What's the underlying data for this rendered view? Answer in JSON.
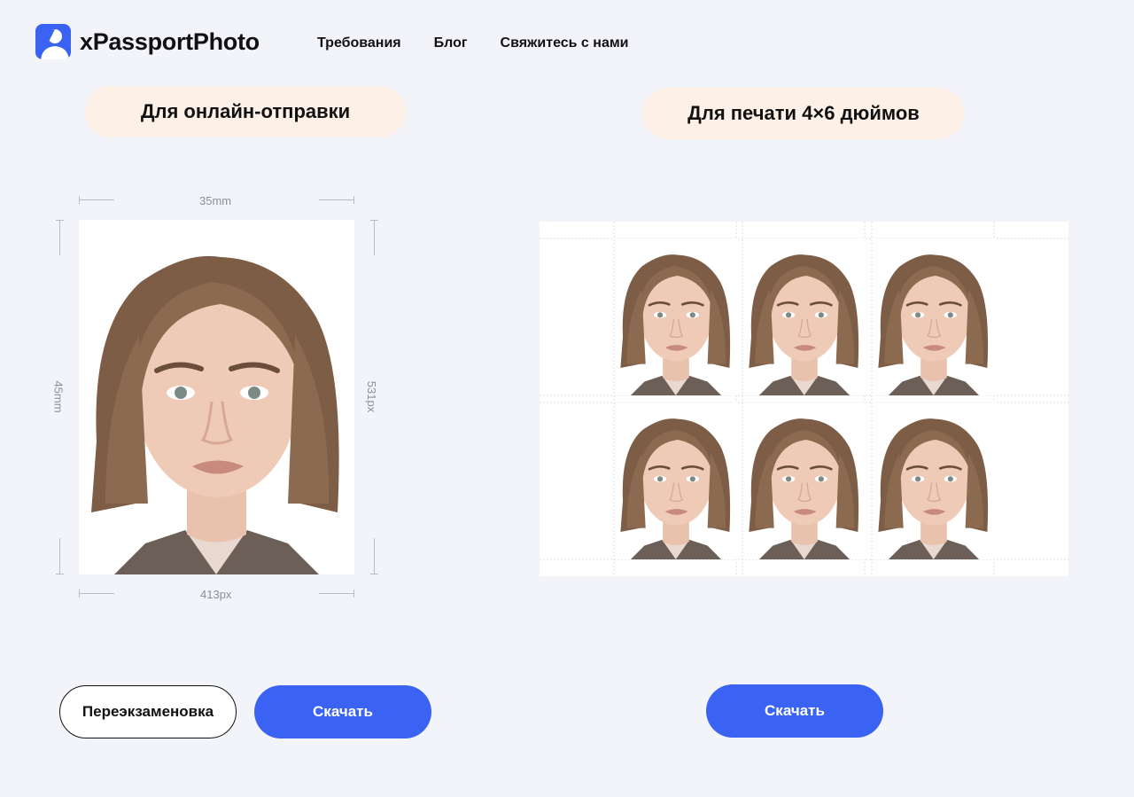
{
  "header": {
    "brand": "xPassportPhoto",
    "nav": [
      {
        "label": "Требования"
      },
      {
        "label": "Блог"
      },
      {
        "label": "Свяжитесь с нами"
      }
    ]
  },
  "sections": {
    "online_title": "Для онлайн-отправки",
    "print_title": "Для печати 4×6 дюймов"
  },
  "dimensions": {
    "width_mm": "35mm",
    "height_mm": "45mm",
    "width_px": "413px",
    "height_px": "531px"
  },
  "buttons": {
    "retake": "Переэкзаменовка",
    "download_left": "Скачать",
    "download_right": "Скачать"
  },
  "colors": {
    "accent": "#3a63f4",
    "pill_bg": "#fdf0e6",
    "page_bg": "#f3f4f9"
  }
}
